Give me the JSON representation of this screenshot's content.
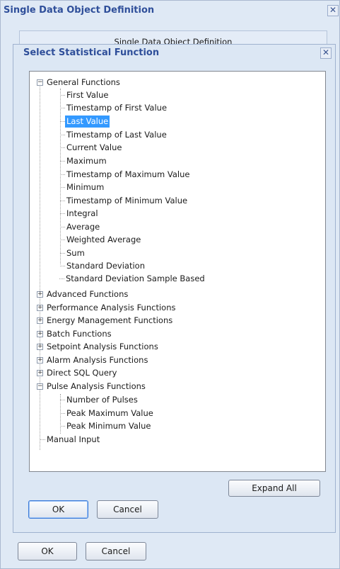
{
  "outer_dialog": {
    "title": "Single Data Object Definition",
    "panel_title": "Single Data Object Definition",
    "ok_label": "OK",
    "cancel_label": "Cancel"
  },
  "inner_dialog": {
    "title": "Select Statistical Function",
    "expand_all_label": "Expand All",
    "ok_label": "OK",
    "cancel_label": "Cancel",
    "selected_item": "Last Value"
  },
  "tree": {
    "general": {
      "label": "General Functions",
      "expanded": true,
      "children": [
        "First Value",
        "Timestamp of First Value",
        "Last Value",
        "Timestamp of Last Value",
        "Current Value",
        "Maximum",
        "Timestamp of Maximum Value",
        "Minimum",
        "Timestamp of Minimum Value",
        "Integral",
        "Average",
        "Weighted Average",
        "Sum",
        "Standard Deviation",
        "Standard Deviation Sample Based"
      ]
    },
    "collapsed": [
      "Advanced Functions",
      "Performance Analysis Functions",
      "Energy Management Functions",
      "Batch Functions",
      "Setpoint Analysis Functions",
      "Alarm Analysis Functions",
      "Direct SQL Query"
    ],
    "pulse": {
      "label": "Pulse Analysis Functions",
      "expanded": true,
      "children": [
        "Number of Pulses",
        "Peak Maximum Value",
        "Peak Minimum Value"
      ]
    },
    "manual_input": "Manual Input"
  }
}
